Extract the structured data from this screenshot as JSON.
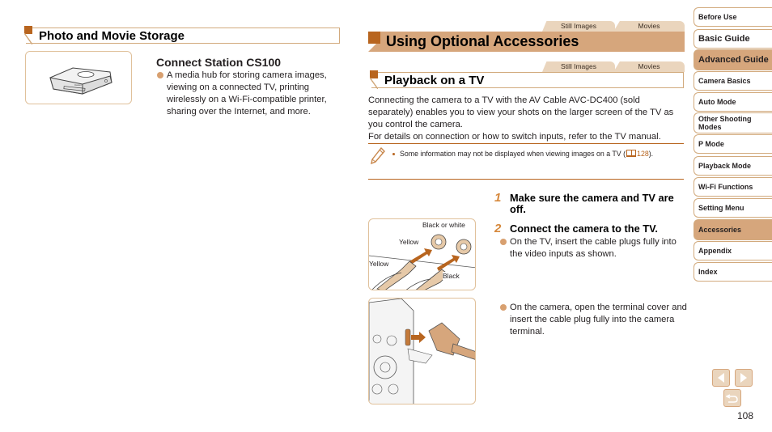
{
  "left_section": {
    "heading": "Photo and Movie Storage",
    "product": {
      "name": "Connect Station CS100",
      "description": "A media hub for storing camera images, viewing on a connected TV, printing wirelessly on a Wi-Fi-compatible printer, sharing over the Internet, and more.",
      "image_icon": "connect-station-device-illustration"
    }
  },
  "main_section": {
    "tabs": [
      "Still Images",
      "Movies"
    ],
    "heading": "Using Optional Accessories",
    "sub_section": {
      "tabs": [
        "Still Images",
        "Movies"
      ],
      "heading": "Playback on a TV",
      "intro_line1": "Connecting the camera to a TV with the AV Cable AVC-DC400 (sold separately) enables you to view your shots on the larger screen of the TV as you control the camera.",
      "intro_line2": "For details on connection or how to switch inputs, refer to the TV manual.",
      "note": {
        "icon": "pencil-icon",
        "text": "Some information may not be displayed when viewing images on a TV (",
        "page_ref": "128",
        "text_end": ")."
      },
      "steps": [
        {
          "number": "1",
          "title": "Make sure the camera and TV are off."
        },
        {
          "number": "2",
          "title": "Connect the camera to the TV.",
          "bullets": [
            "On the TV, insert the cable plugs fully into the video inputs as shown.",
            "On the camera, open the terminal cover and insert the cable plug fully into the camera terminal."
          ]
        }
      ],
      "tv_diagram_labels": {
        "black_or_white": "Black or white",
        "yellow_jack": "Yellow",
        "yellow_plug": "Yellow",
        "black_plug": "Black"
      }
    }
  },
  "nav": {
    "items": [
      {
        "label": "Before Use",
        "active": false,
        "big": false
      },
      {
        "label": "Basic Guide",
        "active": false,
        "big": true
      },
      {
        "label": "Advanced Guide",
        "active": true,
        "big": true
      },
      {
        "label": "Camera Basics",
        "active": false,
        "big": false
      },
      {
        "label": "Auto Mode",
        "active": false,
        "big": false
      },
      {
        "label": "Other Shooting Modes",
        "active": false,
        "big": false
      },
      {
        "label": "P Mode",
        "active": false,
        "big": false
      },
      {
        "label": "Playback Mode",
        "active": false,
        "big": false
      },
      {
        "label": "Wi-Fi Functions",
        "active": false,
        "big": false
      },
      {
        "label": "Setting Menu",
        "active": false,
        "big": false
      },
      {
        "label": "Accessories",
        "active": true,
        "big": false
      },
      {
        "label": "Appendix",
        "active": false,
        "big": false
      },
      {
        "label": "Index",
        "active": false,
        "big": false
      }
    ],
    "prev_icon": "triangle-left-icon",
    "next_icon": "triangle-right-icon",
    "return_icon": "return-arrow-icon"
  },
  "page_number": "108",
  "colors": {
    "accent_dark": "#b8651f",
    "accent_mid": "#d6a67c",
    "accent_light": "#ead5bd",
    "border": "#d2aa7d",
    "bullet": "#d8a070"
  }
}
